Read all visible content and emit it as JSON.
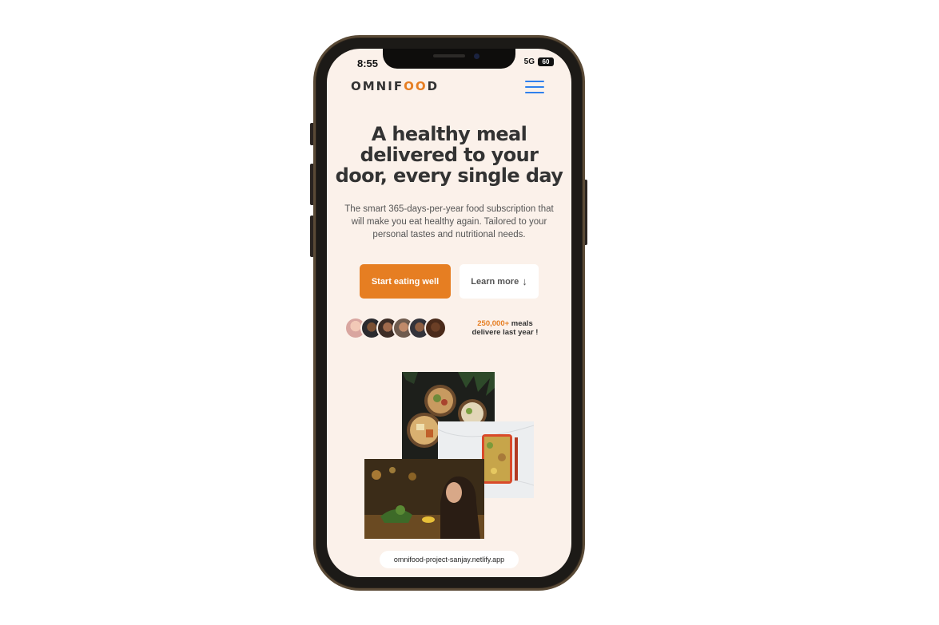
{
  "status": {
    "time": "8:55",
    "network": "5G",
    "battery": "60"
  },
  "logo": {
    "text_before": "OMNIF",
    "text_oo": "OO",
    "text_after": "D"
  },
  "hero": {
    "headline": "A healthy meal delivered to your door, every single day",
    "description": "The smart 365-days-per-year food subscription that will make you eat healthy again. Tailored to your personal tastes and nutritional needs."
  },
  "buttons": {
    "primary": "Start eating well",
    "secondary": "Learn more",
    "secondary_arrow": "↓"
  },
  "delivered": {
    "count": "250,000+",
    "line1_suffix": "meals",
    "line2": "delivere last year !"
  },
  "browser": {
    "url": "omnifood-project-sanjay.netlify.app"
  },
  "colors": {
    "accent": "#e67e22",
    "background": "#fbf1ea",
    "menu": "#2f80ed"
  },
  "icons": {
    "menu": "hamburger-menu-icon",
    "avatars": "customer-avatar"
  }
}
